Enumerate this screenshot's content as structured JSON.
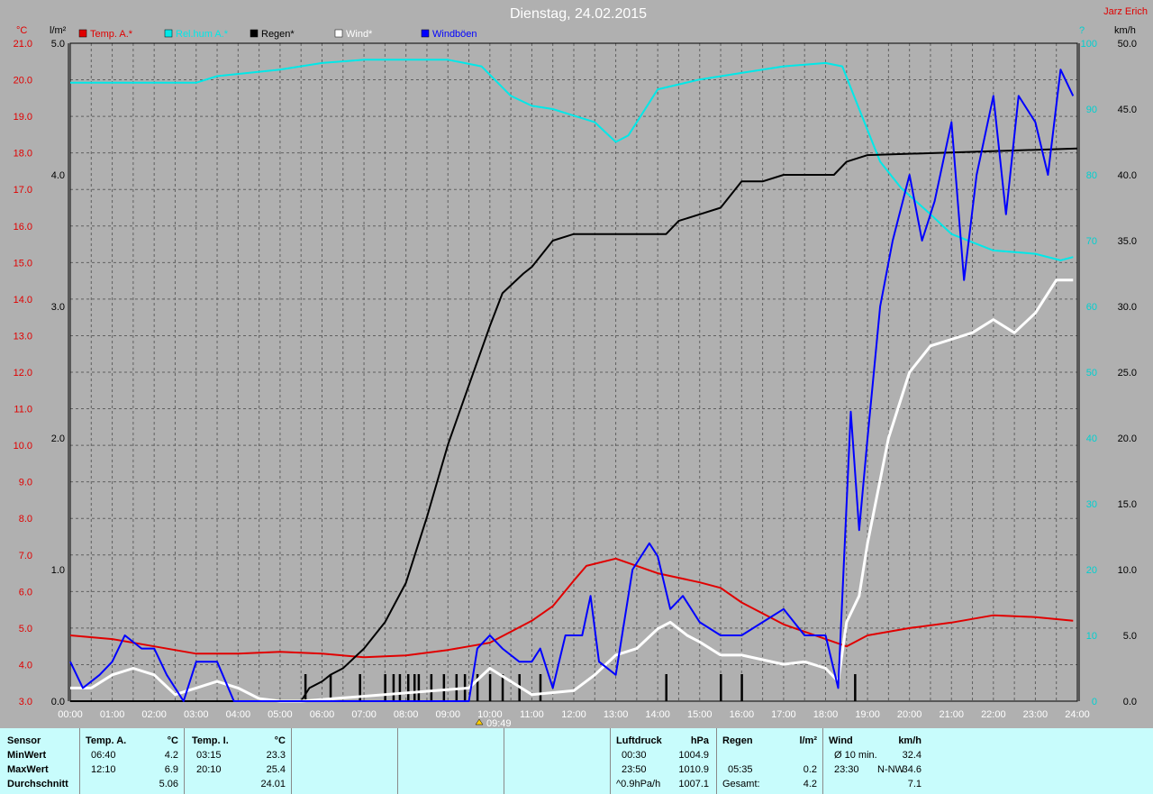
{
  "header": {
    "title": "Dienstag, 24.02.2015",
    "author": "Jarz Erich",
    "unit_temp": "°C",
    "unit_rain": "l/m²",
    "unit_pressure": "?",
    "unit_wind": "km/h",
    "marker_label": "09:49"
  },
  "legend": [
    {
      "label": "Temp. A.*",
      "color": "#e00000"
    },
    {
      "label": "Rel.hum A.*",
      "color": "#00e8e8"
    },
    {
      "label": "Regen*",
      "color": "#000000"
    },
    {
      "label": "Wind*",
      "color": "#ffffff"
    },
    {
      "label": "Windböen",
      "color": "#0000ff"
    }
  ],
  "chart_data": {
    "type": "line",
    "title": "Dienstag, 24.02.2015",
    "x_ticks": [
      "00:00",
      "01:00",
      "02:00",
      "03:00",
      "04:00",
      "05:00",
      "06:00",
      "07:00",
      "08:00",
      "09:00",
      "10:00",
      "11:00",
      "12:00",
      "13:00",
      "14:00",
      "15:00",
      "16:00",
      "17:00",
      "18:00",
      "19:00",
      "20:00",
      "21:00",
      "22:00",
      "23:00",
      "24:00"
    ],
    "axes": {
      "temp": {
        "label": "°C",
        "min": 3.0,
        "max": 21.0,
        "ticks": [
          "21.0",
          "20.0",
          "19.0",
          "18.0",
          "17.0",
          "16.0",
          "15.0",
          "14.0",
          "13.0",
          "12.0",
          "11.0",
          "10.0",
          "9.0",
          "8.0",
          "7.0",
          "6.0",
          "5.0",
          "4.0",
          "3.0"
        ]
      },
      "rain": {
        "label": "l/m²",
        "min": 0.0,
        "max": 5.0,
        "ticks": [
          "5.0",
          "4.0",
          "3.0",
          "2.0",
          "1.0",
          "0.0"
        ]
      },
      "secondary": {
        "label": "?",
        "min": 0,
        "max": 100,
        "ticks": [
          "100",
          "90",
          "80",
          "70",
          "60",
          "50",
          "40",
          "30",
          "20",
          "10",
          "0"
        ]
      },
      "wind": {
        "label": "km/h",
        "min": 0.0,
        "max": 50.0,
        "ticks": [
          "50.0",
          "45.0",
          "40.0",
          "35.0",
          "30.0",
          "25.0",
          "20.0",
          "15.0",
          "10.0",
          "5.0",
          "0.0"
        ]
      }
    },
    "grid": true,
    "series": [
      {
        "name": "Temp. A.*",
        "axis": "temp",
        "color": "#e00000",
        "points": [
          [
            0,
            4.8
          ],
          [
            1,
            4.7
          ],
          [
            2,
            4.5
          ],
          [
            3,
            4.3
          ],
          [
            4,
            4.3
          ],
          [
            5,
            4.35
          ],
          [
            6,
            4.3
          ],
          [
            7,
            4.2
          ],
          [
            8,
            4.25
          ],
          [
            9,
            4.4
          ],
          [
            9.5,
            4.5
          ],
          [
            10,
            4.6
          ],
          [
            11,
            5.2
          ],
          [
            11.5,
            5.6
          ],
          [
            12,
            6.3
          ],
          [
            12.3,
            6.7
          ],
          [
            13,
            6.9
          ],
          [
            13.5,
            6.7
          ],
          [
            14,
            6.5
          ],
          [
            15,
            6.25
          ],
          [
            15.5,
            6.1
          ],
          [
            16,
            5.7
          ],
          [
            17,
            5.1
          ],
          [
            18,
            4.7
          ],
          [
            18.5,
            4.5
          ],
          [
            19,
            4.8
          ],
          [
            20,
            5.0
          ],
          [
            21,
            5.15
          ],
          [
            22,
            5.35
          ],
          [
            23,
            5.3
          ],
          [
            23.9,
            5.2
          ]
        ]
      },
      {
        "name": "Rel.hum A.*",
        "axis": "secondary",
        "color": "#00e8e8",
        "points": [
          [
            0,
            94
          ],
          [
            3,
            94
          ],
          [
            3.5,
            95
          ],
          [
            5,
            96
          ],
          [
            6,
            97
          ],
          [
            7,
            97.5
          ],
          [
            9,
            97.5
          ],
          [
            9.8,
            96.5
          ],
          [
            10.5,
            92
          ],
          [
            11,
            90.5
          ],
          [
            11.5,
            90
          ],
          [
            12,
            89
          ],
          [
            12.5,
            88
          ],
          [
            13,
            85
          ],
          [
            13.3,
            86
          ],
          [
            14,
            93
          ],
          [
            15,
            94.5
          ],
          [
            16,
            95.5
          ],
          [
            17,
            96.5
          ],
          [
            18,
            97
          ],
          [
            18.4,
            96.5
          ],
          [
            18.8,
            90
          ],
          [
            19.3,
            82
          ],
          [
            19.8,
            78
          ],
          [
            20.5,
            74
          ],
          [
            21,
            71
          ],
          [
            22,
            68.5
          ],
          [
            23,
            68
          ],
          [
            23.6,
            67
          ],
          [
            23.9,
            67.5
          ]
        ]
      },
      {
        "name": "Regen*",
        "axis": "rain",
        "color": "#000000",
        "points": [
          [
            0,
            0
          ],
          [
            5.5,
            0
          ],
          [
            5.7,
            0.1
          ],
          [
            6,
            0.15
          ],
          [
            6.2,
            0.2
          ],
          [
            6.5,
            0.25
          ],
          [
            7,
            0.4
          ],
          [
            7.5,
            0.6
          ],
          [
            8,
            0.9
          ],
          [
            8.5,
            1.4
          ],
          [
            9,
            1.95
          ],
          [
            9.5,
            2.4
          ],
          [
            10,
            2.85
          ],
          [
            10.3,
            3.1
          ],
          [
            10.8,
            3.25
          ],
          [
            11,
            3.3
          ],
          [
            11.5,
            3.5
          ],
          [
            12,
            3.55
          ],
          [
            13,
            3.55
          ],
          [
            14.2,
            3.55
          ],
          [
            14.5,
            3.65
          ],
          [
            15,
            3.7
          ],
          [
            15.5,
            3.75
          ],
          [
            16,
            3.95
          ],
          [
            16.5,
            3.95
          ],
          [
            17,
            4.0
          ],
          [
            18.2,
            4.0
          ],
          [
            18.5,
            4.1
          ],
          [
            19,
            4.15
          ],
          [
            24,
            4.2
          ]
        ]
      },
      {
        "name": "Wind*",
        "axis": "wind",
        "color": "#ffffff",
        "points": [
          [
            0,
            1
          ],
          [
            0.5,
            1
          ],
          [
            1,
            2
          ],
          [
            1.5,
            2.5
          ],
          [
            2,
            2
          ],
          [
            2.5,
            0.5
          ],
          [
            3,
            1
          ],
          [
            3.5,
            1.5
          ],
          [
            4,
            1
          ],
          [
            4.5,
            0.2
          ],
          [
            5,
            0
          ],
          [
            5.5,
            0
          ],
          [
            9.5,
            1
          ],
          [
            10,
            2.5
          ],
          [
            10.5,
            1.5
          ],
          [
            11,
            0.5
          ],
          [
            12,
            0.8
          ],
          [
            12.5,
            2
          ],
          [
            13,
            3.5
          ],
          [
            13.5,
            4
          ],
          [
            14,
            5.5
          ],
          [
            14.3,
            6
          ],
          [
            14.7,
            5
          ],
          [
            15,
            4.5
          ],
          [
            15.5,
            3.5
          ],
          [
            16,
            3.5
          ],
          [
            17,
            2.8
          ],
          [
            17.5,
            3
          ],
          [
            18,
            2.5
          ],
          [
            18.3,
            1.5
          ],
          [
            18.5,
            6
          ],
          [
            18.8,
            8
          ],
          [
            19,
            12
          ],
          [
            19.5,
            20
          ],
          [
            20,
            25
          ],
          [
            20.5,
            27
          ],
          [
            21,
            27.5
          ],
          [
            21.5,
            28
          ],
          [
            22,
            29
          ],
          [
            22.5,
            28
          ],
          [
            23,
            29.5
          ],
          [
            23.5,
            32
          ],
          [
            23.9,
            32
          ]
        ]
      },
      {
        "name": "Windböen",
        "axis": "wind",
        "color": "#0000ff",
        "points": [
          [
            0,
            3
          ],
          [
            0.3,
            1
          ],
          [
            0.7,
            2
          ],
          [
            1,
            3
          ],
          [
            1.3,
            5
          ],
          [
            1.7,
            4
          ],
          [
            2,
            4
          ],
          [
            2.3,
            2
          ],
          [
            2.7,
            0
          ],
          [
            3,
            3
          ],
          [
            3.5,
            3
          ],
          [
            3.9,
            0
          ],
          [
            4,
            0
          ],
          [
            9.5,
            0
          ],
          [
            9.7,
            4
          ],
          [
            10,
            5
          ],
          [
            10.3,
            4
          ],
          [
            10.7,
            3
          ],
          [
            11,
            3
          ],
          [
            11.2,
            4
          ],
          [
            11.5,
            1
          ],
          [
            11.8,
            5
          ],
          [
            12.2,
            5
          ],
          [
            12.4,
            8
          ],
          [
            12.6,
            3
          ],
          [
            13,
            2
          ],
          [
            13.4,
            10
          ],
          [
            13.8,
            12
          ],
          [
            14,
            11
          ],
          [
            14.3,
            7
          ],
          [
            14.6,
            8
          ],
          [
            15,
            6
          ],
          [
            15.5,
            5
          ],
          [
            16,
            5
          ],
          [
            16.5,
            6
          ],
          [
            17,
            7
          ],
          [
            17.5,
            5
          ],
          [
            18,
            5
          ],
          [
            18.3,
            1
          ],
          [
            18.6,
            22
          ],
          [
            18.8,
            13
          ],
          [
            19,
            20
          ],
          [
            19.3,
            30
          ],
          [
            19.6,
            35
          ],
          [
            20,
            40
          ],
          [
            20.3,
            35
          ],
          [
            20.6,
            38
          ],
          [
            21,
            44
          ],
          [
            21.3,
            32
          ],
          [
            21.6,
            40
          ],
          [
            22,
            46
          ],
          [
            22.3,
            37
          ],
          [
            22.6,
            46
          ],
          [
            23,
            44
          ],
          [
            23.3,
            40
          ],
          [
            23.6,
            48
          ],
          [
            23.9,
            46
          ]
        ]
      }
    ],
    "rain_bars_hours": [
      5.6,
      6.2,
      6.9,
      7.5,
      7.7,
      7.85,
      8.05,
      8.2,
      8.3,
      8.6,
      8.9,
      9.2,
      9.4,
      9.7,
      10.0,
      10.3,
      10.7,
      11.2,
      14.2,
      15.5,
      16.0,
      18.7
    ]
  },
  "table": {
    "col1": {
      "h": "Sensor",
      "r1": "MinWert",
      "r2": "MaxWert",
      "r3": "Durchschnitt"
    },
    "col2": {
      "h": "Temp. A.",
      "u": "°C",
      "r1t": "06:40",
      "r1v": "4.2",
      "r2t": "12:10",
      "r2v": "6.9",
      "r3v": "5.06"
    },
    "col3": {
      "h": "Temp. I.",
      "u": "°C",
      "r1t": "03:15",
      "r1v": "23.3",
      "r2t": "20:10",
      "r2v": "25.4",
      "r3v": "24.01"
    },
    "col4": {
      "h": "Luftdruck",
      "u": "hPa",
      "r1t": "00:30",
      "r1v": "1004.9",
      "r2t": "23:50",
      "r2v": "1010.9",
      "r3t": "^0.9hPa/h",
      "r3v": "1007.1"
    },
    "col5": {
      "h": "Regen",
      "u": "l/m²",
      "r2t": "05:35",
      "r2v": "0.2",
      "r3t": "Gesamt:",
      "r3v": "4.2"
    },
    "col6": {
      "h": "Wind",
      "u": "km/h",
      "r1t": "Ø 10 min.",
      "r1v": "32.4",
      "r2t": "23:30",
      "r2m": "N-NW",
      "r2v": "34.6",
      "r3v": "7.1"
    }
  }
}
